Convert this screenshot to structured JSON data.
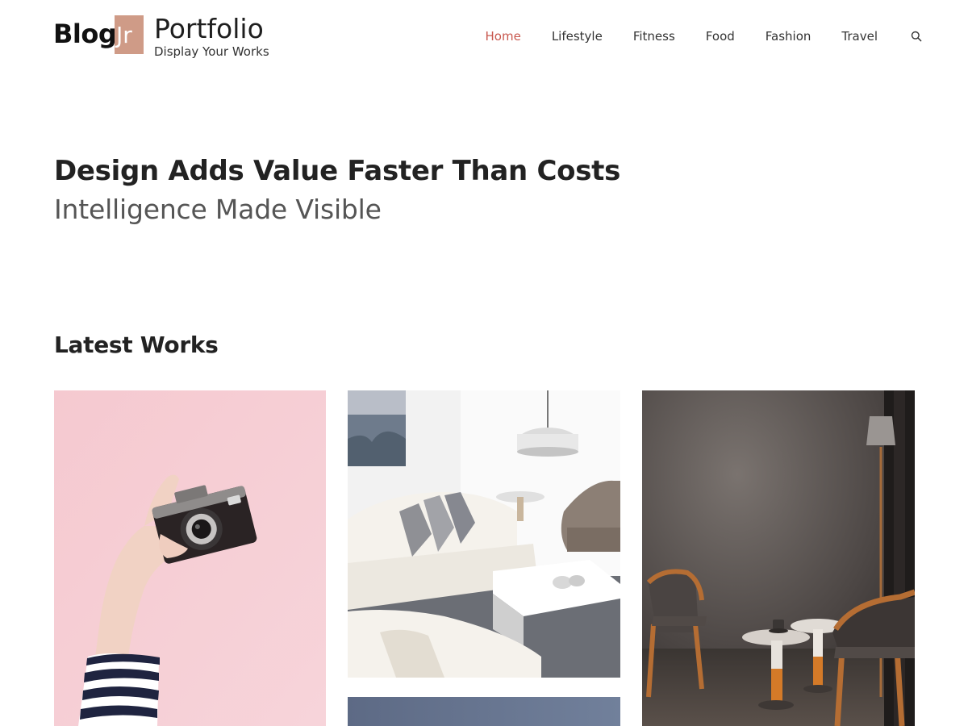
{
  "site": {
    "logo_blog": "Blog",
    "logo_jr": "Jr",
    "title": "Portfolio",
    "tagline": "Display Your Works",
    "accent_color": "#c8584e",
    "logo_badge_color": "#cf9b87"
  },
  "nav": {
    "items": [
      {
        "label": "Home",
        "active": true
      },
      {
        "label": "Lifestyle",
        "active": false
      },
      {
        "label": "Fitness",
        "active": false
      },
      {
        "label": "Food",
        "active": false
      },
      {
        "label": "Fashion",
        "active": false
      },
      {
        "label": "Travel",
        "active": false
      }
    ],
    "search_icon": "search-icon"
  },
  "hero": {
    "title": "Design Adds Value Faster Than Costs",
    "subtitle": "Intelligence Made Visible"
  },
  "latest_works": {
    "heading": "Latest Works",
    "items": [
      {
        "image": "hand-holding-camera-on-pink-wall"
      },
      {
        "image": "white-living-room-with-sofa-and-pendant-lamp"
      },
      {
        "image": "dark-room-with-wooden-chairs-and-side-tables"
      },
      {
        "image": "blue-gray-image-partially-visible"
      }
    ]
  }
}
